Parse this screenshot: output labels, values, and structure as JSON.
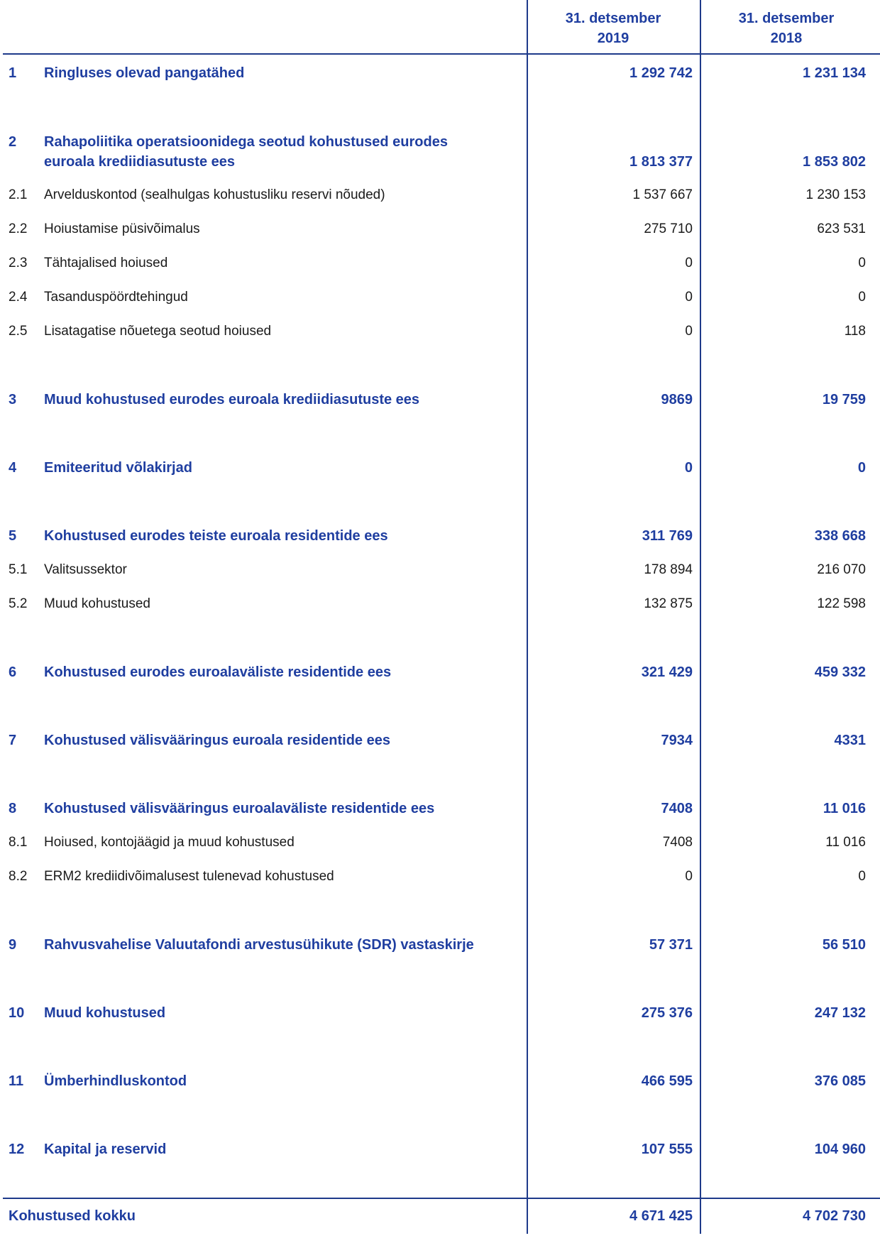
{
  "header": {
    "col1": [
      "31. detsember",
      "2019"
    ],
    "col2": [
      "31. detsember",
      "2018"
    ]
  },
  "rows": [
    {
      "kind": "main",
      "num": "1",
      "label": [
        "Ringluses olevad pangatähed"
      ],
      "v1": "1 292 742",
      "v2": "1 231 134"
    },
    {
      "kind": "main",
      "num": "2",
      "label": [
        "Rahapoliitika operatsioonidega seotud kohustused eurodes",
        "euroala krediidiasutuste ees"
      ],
      "v1": "1 813 377",
      "v2": "1 853 802"
    },
    {
      "kind": "sub",
      "num": "2.1",
      "label": [
        "Arvelduskontod (sealhulgas kohustusliku reservi nõuded)"
      ],
      "v1": "1 537 667",
      "v2": "1 230 153"
    },
    {
      "kind": "sub",
      "num": "2.2",
      "label": [
        "Hoiustamise püsivõimalus"
      ],
      "v1": "275 710",
      "v2": "623 531"
    },
    {
      "kind": "sub",
      "num": "2.3",
      "label": [
        "Tähtajalised hoiused"
      ],
      "v1": "0",
      "v2": "0"
    },
    {
      "kind": "sub",
      "num": "2.4",
      "label": [
        "Tasanduspöördtehingud"
      ],
      "v1": "0",
      "v2": "0"
    },
    {
      "kind": "sub",
      "num": "2.5",
      "label": [
        "Lisatagatise nõuetega seotud hoiused"
      ],
      "v1": "0",
      "v2": "118"
    },
    {
      "kind": "main",
      "num": "3",
      "label": [
        "Muud kohustused eurodes euroala krediidiasutuste ees"
      ],
      "v1": "9869",
      "v2": "19 759"
    },
    {
      "kind": "main",
      "num": "4",
      "label": [
        "Emiteeritud võlakirjad"
      ],
      "v1": "0",
      "v2": "0"
    },
    {
      "kind": "main",
      "num": "5",
      "label": [
        "Kohustused eurodes teiste euroala residentide ees"
      ],
      "v1": "311 769",
      "v2": "338 668"
    },
    {
      "kind": "sub",
      "num": "5.1",
      "label": [
        "Valitsussektor"
      ],
      "v1": "178 894",
      "v2": "216 070"
    },
    {
      "kind": "sub",
      "num": "5.2",
      "label": [
        "Muud kohustused"
      ],
      "v1": "132 875",
      "v2": "122 598"
    },
    {
      "kind": "main",
      "num": "6",
      "label": [
        "Kohustused eurodes euroalaväliste residentide ees"
      ],
      "v1": "321 429",
      "v2": "459 332"
    },
    {
      "kind": "main",
      "num": "7",
      "label": [
        "Kohustused välisvääringus euroala residentide ees"
      ],
      "v1": "7934",
      "v2": "4331"
    },
    {
      "kind": "main",
      "num": "8",
      "label": [
        "Kohustused välisvääringus euroalaväliste residentide ees"
      ],
      "v1": "7408",
      "v2": "11 016"
    },
    {
      "kind": "sub",
      "num": "8.1",
      "label": [
        "Hoiused, kontojäägid ja muud kohustused"
      ],
      "v1": "7408",
      "v2": "11 016"
    },
    {
      "kind": "sub",
      "num": "8.2",
      "label": [
        "ERM2 krediidivõimalusest tulenevad kohustused"
      ],
      "v1": "0",
      "v2": "0"
    },
    {
      "kind": "main",
      "num": "9",
      "label": [
        "Rahvusvahelise Valuutafondi arvestusühikute (SDR) vastaskirje"
      ],
      "v1": "57 371",
      "v2": "56 510"
    },
    {
      "kind": "main",
      "num": "10",
      "label": [
        "Muud kohustused"
      ],
      "v1": "275 376",
      "v2": "247 132"
    },
    {
      "kind": "main",
      "num": "11",
      "label": [
        "Ümberhindluskontod"
      ],
      "v1": "466 595",
      "v2": "376 085"
    },
    {
      "kind": "main",
      "num": "12",
      "label": [
        "Kapital ja reservid"
      ],
      "v1": "107 555",
      "v2": "104 960"
    }
  ],
  "total": {
    "label": "Kohustused kokku",
    "v1": "4 671 425",
    "v2": "4 702 730"
  }
}
